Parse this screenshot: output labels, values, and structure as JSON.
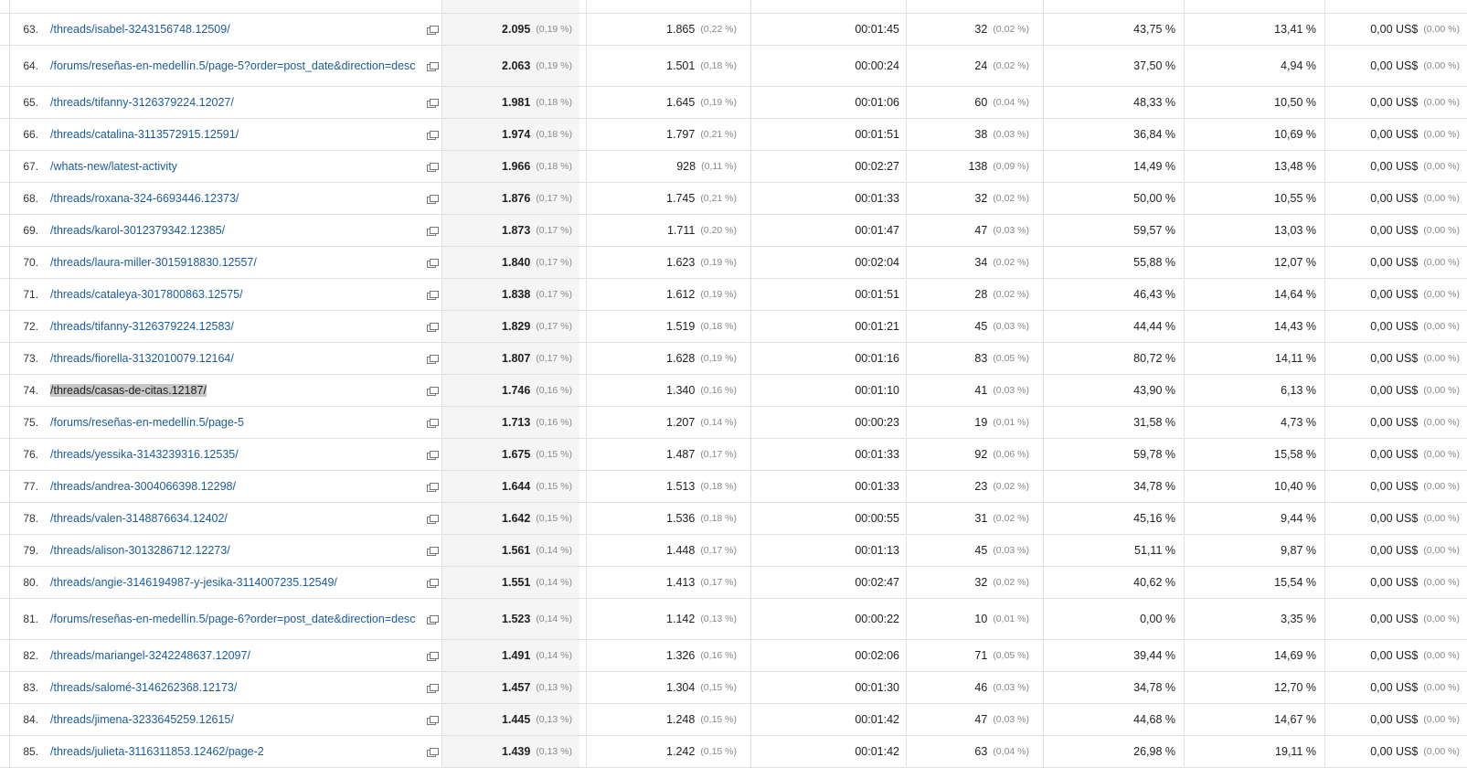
{
  "rows": [
    {
      "idx": "63.",
      "page": "/threads/isabel-3243156748.12509/",
      "pv": "2.095",
      "pv_pct": "(0,19 %)",
      "upv": "1.865",
      "upv_pct": "(0,22 %)",
      "avg": "00:01:45",
      "ent": "32",
      "ent_pct": "(0,02 %)",
      "bounce": "43,75 %",
      "exit": "13,41 %",
      "val": "0,00 US$",
      "val_pct": "(0,00 %)"
    },
    {
      "idx": "64.",
      "page": "/forums/reseñas-en-medellín.5/page-5?order=post_date&direction=desc",
      "pv": "2.063",
      "pv_pct": "(0,19 %)",
      "upv": "1.501",
      "upv_pct": "(0,18 %)",
      "avg": "00:00:24",
      "ent": "24",
      "ent_pct": "(0,02 %)",
      "bounce": "37,50 %",
      "exit": "4,94 %",
      "val": "0,00 US$",
      "val_pct": "(0,00 %)",
      "tall": true
    },
    {
      "idx": "65.",
      "page": "/threads/tifanny-3126379224.12027/",
      "pv": "1.981",
      "pv_pct": "(0,18 %)",
      "upv": "1.645",
      "upv_pct": "(0,19 %)",
      "avg": "00:01:06",
      "ent": "60",
      "ent_pct": "(0,04 %)",
      "bounce": "48,33 %",
      "exit": "10,50 %",
      "val": "0,00 US$",
      "val_pct": "(0,00 %)"
    },
    {
      "idx": "66.",
      "page": "/threads/catalina-3113572915.12591/",
      "pv": "1.974",
      "pv_pct": "(0,18 %)",
      "upv": "1.797",
      "upv_pct": "(0,21 %)",
      "avg": "00:01:51",
      "ent": "38",
      "ent_pct": "(0,03 %)",
      "bounce": "36,84 %",
      "exit": "10,69 %",
      "val": "0,00 US$",
      "val_pct": "(0,00 %)"
    },
    {
      "idx": "67.",
      "page": "/whats-new/latest-activity",
      "pv": "1.966",
      "pv_pct": "(0,18 %)",
      "upv": "928",
      "upv_pct": "(0,11 %)",
      "avg": "00:02:27",
      "ent": "138",
      "ent_pct": "(0,09 %)",
      "bounce": "14,49 %",
      "exit": "13,48 %",
      "val": "0,00 US$",
      "val_pct": "(0,00 %)"
    },
    {
      "idx": "68.",
      "page": "/threads/roxana-324-6693446.12373/",
      "pv": "1.876",
      "pv_pct": "(0,17 %)",
      "upv": "1.745",
      "upv_pct": "(0,21 %)",
      "avg": "00:01:33",
      "ent": "32",
      "ent_pct": "(0,02 %)",
      "bounce": "50,00 %",
      "exit": "10,55 %",
      "val": "0,00 US$",
      "val_pct": "(0,00 %)"
    },
    {
      "idx": "69.",
      "page": "/threads/karol-3012379342.12385/",
      "pv": "1.873",
      "pv_pct": "(0,17 %)",
      "upv": "1.711",
      "upv_pct": "(0,20 %)",
      "avg": "00:01:47",
      "ent": "47",
      "ent_pct": "(0,03 %)",
      "bounce": "59,57 %",
      "exit": "13,03 %",
      "val": "0,00 US$",
      "val_pct": "(0,00 %)"
    },
    {
      "idx": "70.",
      "page": "/threads/laura-miller-3015918830.12557/",
      "pv": "1.840",
      "pv_pct": "(0,17 %)",
      "upv": "1.623",
      "upv_pct": "(0,19 %)",
      "avg": "00:02:04",
      "ent": "34",
      "ent_pct": "(0,02 %)",
      "bounce": "55,88 %",
      "exit": "12,07 %",
      "val": "0,00 US$",
      "val_pct": "(0,00 %)"
    },
    {
      "idx": "71.",
      "page": "/threads/cataleya-3017800863.12575/",
      "pv": "1.838",
      "pv_pct": "(0,17 %)",
      "upv": "1.612",
      "upv_pct": "(0,19 %)",
      "avg": "00:01:51",
      "ent": "28",
      "ent_pct": "(0,02 %)",
      "bounce": "46,43 %",
      "exit": "14,64 %",
      "val": "0,00 US$",
      "val_pct": "(0,00 %)"
    },
    {
      "idx": "72.",
      "page": "/threads/tifanny-3126379224.12583/",
      "pv": "1.829",
      "pv_pct": "(0,17 %)",
      "upv": "1.519",
      "upv_pct": "(0,18 %)",
      "avg": "00:01:21",
      "ent": "45",
      "ent_pct": "(0,03 %)",
      "bounce": "44,44 %",
      "exit": "14,43 %",
      "val": "0,00 US$",
      "val_pct": "(0,00 %)"
    },
    {
      "idx": "73.",
      "page": "/threads/fiorella-3132010079.12164/",
      "pv": "1.807",
      "pv_pct": "(0,17 %)",
      "upv": "1.628",
      "upv_pct": "(0,19 %)",
      "avg": "00:01:16",
      "ent": "83",
      "ent_pct": "(0,05 %)",
      "bounce": "80,72 %",
      "exit": "14,11 %",
      "val": "0,00 US$",
      "val_pct": "(0,00 %)"
    },
    {
      "idx": "74.",
      "page": "/threads/casas-de-citas.12187/",
      "pv": "1.746",
      "pv_pct": "(0,16 %)",
      "upv": "1.340",
      "upv_pct": "(0,16 %)",
      "avg": "00:01:10",
      "ent": "41",
      "ent_pct": "(0,03 %)",
      "bounce": "43,90 %",
      "exit": "6,13 %",
      "val": "0,00 US$",
      "val_pct": "(0,00 %)",
      "highlight": true
    },
    {
      "idx": "75.",
      "page": "/forums/reseñas-en-medellín.5/page-5",
      "pv": "1.713",
      "pv_pct": "(0,16 %)",
      "upv": "1.207",
      "upv_pct": "(0,14 %)",
      "avg": "00:00:23",
      "ent": "19",
      "ent_pct": "(0,01 %)",
      "bounce": "31,58 %",
      "exit": "4,73 %",
      "val": "0,00 US$",
      "val_pct": "(0,00 %)"
    },
    {
      "idx": "76.",
      "page": "/threads/yessika-3143239316.12535/",
      "pv": "1.675",
      "pv_pct": "(0,15 %)",
      "upv": "1.487",
      "upv_pct": "(0,17 %)",
      "avg": "00:01:33",
      "ent": "92",
      "ent_pct": "(0,06 %)",
      "bounce": "59,78 %",
      "exit": "15,58 %",
      "val": "0,00 US$",
      "val_pct": "(0,00 %)"
    },
    {
      "idx": "77.",
      "page": "/threads/andrea-3004066398.12298/",
      "pv": "1.644",
      "pv_pct": "(0,15 %)",
      "upv": "1.513",
      "upv_pct": "(0,18 %)",
      "avg": "00:01:33",
      "ent": "23",
      "ent_pct": "(0,02 %)",
      "bounce": "34,78 %",
      "exit": "10,40 %",
      "val": "0,00 US$",
      "val_pct": "(0,00 %)"
    },
    {
      "idx": "78.",
      "page": "/threads/valen-3148876634.12402/",
      "pv": "1.642",
      "pv_pct": "(0,15 %)",
      "upv": "1.536",
      "upv_pct": "(0,18 %)",
      "avg": "00:00:55",
      "ent": "31",
      "ent_pct": "(0,02 %)",
      "bounce": "45,16 %",
      "exit": "9,44 %",
      "val": "0,00 US$",
      "val_pct": "(0,00 %)"
    },
    {
      "idx": "79.",
      "page": "/threads/alison-3013286712.12273/",
      "pv": "1.561",
      "pv_pct": "(0,14 %)",
      "upv": "1.448",
      "upv_pct": "(0,17 %)",
      "avg": "00:01:13",
      "ent": "45",
      "ent_pct": "(0,03 %)",
      "bounce": "51,11 %",
      "exit": "9,87 %",
      "val": "0,00 US$",
      "val_pct": "(0,00 %)"
    },
    {
      "idx": "80.",
      "page": "/threads/angie-3146194987-y-jesika-3114007235.12549/",
      "pv": "1.551",
      "pv_pct": "(0,14 %)",
      "upv": "1.413",
      "upv_pct": "(0,17 %)",
      "avg": "00:02:47",
      "ent": "32",
      "ent_pct": "(0,02 %)",
      "bounce": "40,62 %",
      "exit": "15,54 %",
      "val": "0,00 US$",
      "val_pct": "(0,00 %)"
    },
    {
      "idx": "81.",
      "page": "/forums/reseñas-en-medellín.5/page-6?order=post_date&direction=desc",
      "pv": "1.523",
      "pv_pct": "(0,14 %)",
      "upv": "1.142",
      "upv_pct": "(0,13 %)",
      "avg": "00:00:22",
      "ent": "10",
      "ent_pct": "(0,01 %)",
      "bounce": "0,00 %",
      "exit": "3,35 %",
      "val": "0,00 US$",
      "val_pct": "(0,00 %)",
      "tall": true
    },
    {
      "idx": "82.",
      "page": "/threads/mariangel-3242248637.12097/",
      "pv": "1.491",
      "pv_pct": "(0,14 %)",
      "upv": "1.326",
      "upv_pct": "(0,16 %)",
      "avg": "00:02:06",
      "ent": "71",
      "ent_pct": "(0,05 %)",
      "bounce": "39,44 %",
      "exit": "14,69 %",
      "val": "0,00 US$",
      "val_pct": "(0,00 %)"
    },
    {
      "idx": "83.",
      "page": "/threads/salomé-3146262368.12173/",
      "pv": "1.457",
      "pv_pct": "(0,13 %)",
      "upv": "1.304",
      "upv_pct": "(0,15 %)",
      "avg": "00:01:30",
      "ent": "46",
      "ent_pct": "(0,03 %)",
      "bounce": "34,78 %",
      "exit": "12,70 %",
      "val": "0,00 US$",
      "val_pct": "(0,00 %)"
    },
    {
      "idx": "84.",
      "page": "/threads/jimena-3233645259.12615/",
      "pv": "1.445",
      "pv_pct": "(0,13 %)",
      "upv": "1.248",
      "upv_pct": "(0,15 %)",
      "avg": "00:01:42",
      "ent": "47",
      "ent_pct": "(0,03 %)",
      "bounce": "44,68 %",
      "exit": "14,67 %",
      "val": "0,00 US$",
      "val_pct": "(0,00 %)"
    },
    {
      "idx": "85.",
      "page": "/threads/julieta-3116311853.12462/page-2",
      "pv": "1.439",
      "pv_pct": "(0,13 %)",
      "upv": "1.242",
      "upv_pct": "(0,15 %)",
      "avg": "00:01:42",
      "ent": "63",
      "ent_pct": "(0,04 %)",
      "bounce": "26,98 %",
      "exit": "19,11 %",
      "val": "0,00 US$",
      "val_pct": "(0,00 %)"
    }
  ],
  "icons": {
    "open_link": "open-in-new-window-icon"
  }
}
